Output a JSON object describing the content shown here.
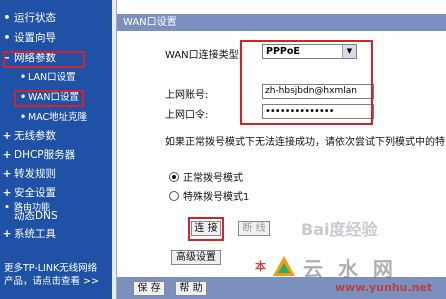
{
  "sidebar": {
    "items": [
      {
        "label": "运行状态",
        "bullet": "•"
      },
      {
        "label": "设置向导",
        "bullet": "•"
      },
      {
        "label": "网络参数",
        "bullet": "–"
      },
      {
        "label": "LAN口设置",
        "bullet": "•"
      },
      {
        "label": "WAN口设置",
        "bullet": "•"
      },
      {
        "label": "MAC地址克隆",
        "bullet": "•"
      },
      {
        "label": "无线参数",
        "bullet": "+"
      },
      {
        "label": "DHCP服务器",
        "bullet": "+"
      },
      {
        "label": "转发规则",
        "bullet": "+"
      },
      {
        "label": "安全设置",
        "bullet": "+"
      },
      {
        "label": "路由功能",
        "bullet": "•"
      },
      {
        "label": "动态DNS",
        "bullet": "•"
      },
      {
        "label": "系统工具",
        "bullet": "+"
      }
    ],
    "footer_line1": "更多TP-LINK无线网络",
    "footer_line2": "产品，请点击查看 >>"
  },
  "main": {
    "title": "WAN口设置",
    "conn_type_label": "WAN口连接类型:",
    "conn_type_value": "PPPoE",
    "account_label": "上网账号:",
    "account_value": "zh-hbsjbdn@hxmlan",
    "password_label": "上网口令:",
    "password_value": "••••••••••••••",
    "note": "如果正常拨号模式下无法连接成功，请依次尝试下列模式中的特",
    "radio_normal": "正常拨号模式",
    "radio_special": "特殊拨号模式1",
    "connect_button": "连 接",
    "disconnect_button": "断 线",
    "advanced_button": "高级设置",
    "save_button": "保 存",
    "help_button": "帮 助"
  },
  "watermarks": {
    "baidu": "Bai度经验",
    "site_cn": "云 水 网",
    "site_url": "www.yunhu.net",
    "ben": "本"
  }
}
